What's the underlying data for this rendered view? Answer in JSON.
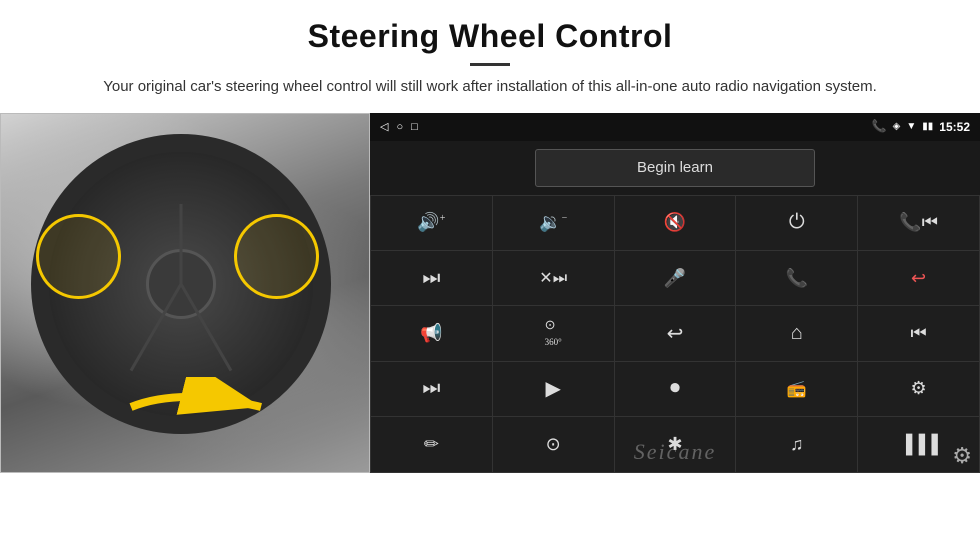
{
  "header": {
    "title": "Steering Wheel Control",
    "divider": true,
    "subtitle": "Your original car's steering wheel control will still work after installation of this all-in-one auto radio navigation system."
  },
  "status_bar": {
    "left_icons": [
      "◁",
      "○",
      "□"
    ],
    "right_icons": [
      "📞",
      "◈",
      "▼"
    ],
    "time": "15:52",
    "signal_icon": "▮▮"
  },
  "begin_learn": {
    "label": "Begin learn"
  },
  "controls": [
    {
      "icon": "🔊+",
      "unicode": "🔊"
    },
    {
      "icon": "🔊-",
      "unicode": "🔉"
    },
    {
      "icon": "🔇",
      "unicode": "🔇"
    },
    {
      "icon": "⏻",
      "unicode": "⏻"
    },
    {
      "icon": "⏮",
      "unicode": "⏮"
    },
    {
      "icon": "⏭",
      "unicode": "⏭"
    },
    {
      "icon": "⏯",
      "unicode": "⏯"
    },
    {
      "icon": "🎤",
      "unicode": "🎤"
    },
    {
      "icon": "📞",
      "unicode": "📞"
    },
    {
      "icon": "↩",
      "unicode": "↩"
    },
    {
      "icon": "📢",
      "unicode": "📢"
    },
    {
      "icon": "360",
      "unicode": "🔄"
    },
    {
      "icon": "↩",
      "unicode": "↩"
    },
    {
      "icon": "🏠",
      "unicode": "⌂"
    },
    {
      "icon": "⏮⏮",
      "unicode": "⏮"
    },
    {
      "icon": "⏭⏭",
      "unicode": "⏭"
    },
    {
      "icon": "◀",
      "unicode": "▶"
    },
    {
      "icon": "⏺",
      "unicode": "⏺"
    },
    {
      "icon": "📻",
      "unicode": "📻"
    },
    {
      "icon": "⚙",
      "unicode": "⚙"
    },
    {
      "icon": "✏",
      "unicode": "✏"
    },
    {
      "icon": "⚙2",
      "unicode": "⊙"
    },
    {
      "icon": "✱",
      "unicode": "✱"
    },
    {
      "icon": "♫",
      "unicode": "♫"
    },
    {
      "icon": "▐▐",
      "unicode": "▐▐"
    }
  ],
  "watermark": {
    "text": "Seicane"
  },
  "gear_icon": "⚙"
}
